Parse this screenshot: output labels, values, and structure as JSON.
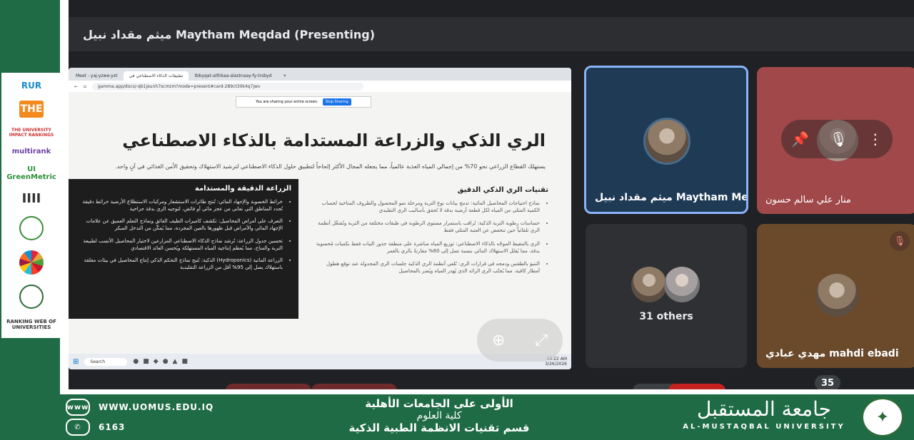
{
  "meet": {
    "presenting_title": "ميثم مقداد نبيل Maytham Meqdad (Presenting)",
    "participants": [
      {
        "name": "ميثم مقداد نبيل Maytham Meq..."
      },
      {
        "name": "منار علي سالم حسون"
      },
      {
        "name": "31 others"
      },
      {
        "name": "مهدي عبادي mahdi ebadi"
      }
    ],
    "participant_count": "35"
  },
  "screen": {
    "browser_tabs": [
      "Meet - yaj-yzwe-yxt",
      "تطبيقات الذكاء الاصطناعي في",
      "tbbyqat-althkaa-alastnaay-fy-trsbyd"
    ],
    "address": "gamma.app/docs/-qb1jeunh7scmzm?mode=present#card-289ct30k4q7jwv",
    "share_notice": "You are sharing your entire screen.",
    "stop_sharing": "Stop Sharing",
    "slide_title": "الري الذكي والزراعة المستدامة بالذكاء الاصطناعي",
    "slide_intro": "يستهلك القطاع الزراعي نحو 70% من إجمالي المياه العذبة عالمياً، مما يجعله المجال الأكثر إلحاحاً لتطبيق حلول الذكاء الاصطناعي لترشيد الاستهلاك وتحقيق الأمن الغذائي في آنٍ واحد.",
    "right_heading": "تقنيات الري الذكي الدقيق",
    "right_items": [
      "نماذج احتياجات المحاصيل المائية: تدمج بيانات نوع التربة ومرحلة نمو المحصول والظروف المناخية لحساب الكمية المثلى من المياه لكل قطعة أرضية بدقة لا تُحقق بأساليب الري التقليدي",
      "حساسات رطوبة التربة الذكية: تُراقب باستمرار مستوى الرطوبة في طبقات مختلفة من التربة وتُشغّل أنظمة الري تلقائياً حين تنخفض عن العتبة المثلى فقط",
      "الري بالتنقيط الموجّه بالذكاء الاصطناعي: توزيع المياه مباشرة على منطقة جذور النبات فقط بكميات مُحسوبة بدقة، مما يُقلل الاستهلاك المائي بنسبة تصل إلى 60% مقارنةً بالري بالغمر",
      "التنبؤ بالطقس ودمجه في قرارات الري: تُلغي أنظمة الري الذكية جلسات الري المجدولة عند توقع هطول أمطار كافية، مما يُجنّب الري الزائد الذي يُهدر المياه ويُضر بالمحاصيل"
    ],
    "left_heading": "الزراعة الدقيقة والمستدامة",
    "left_items": [
      "خرائط الخصوبة والإجهاد المائي: تُنتج طائرات الاستشعار ومركبات الاستطلاع الأرضية خرائط دقيقة تُحدد المناطق التي تعاني من عجز مائي أو فائض، لتوجيه الري بدقة جراحية",
      "التعرف على أمراض المحاصيل: تكشف كاميرات الطيف الفائق ونماذج التعلم العميق عن علامات الإجهاد المائي والأمراض قبل ظهورها بالعين المجردة، مما يُمكّن من التدخل المبكر",
      "تحسين جدول الزراعة: تُرشد نماذج الذكاء الاصطناعي المزارعين لاختيار المحاصيل الأنسب لطبيعة التربة والمناخ، مما يُعظم إنتاجية المياه المستهلكة ويُحسن العائد الاقتصادي",
      "الزراعة المائية (Hydroponics) الذكية: تُتيح نماذج التحكم الذكي إنتاج المحاصيل في بيئات مغلقة باستهلاك يصل إلى 95% أقل من الزراعة التقليدية"
    ],
    "taskbar_search": "Search",
    "taskbar_time": "10:22 AM",
    "taskbar_date": "3/26/2026"
  },
  "logos": [
    "RUR",
    "THE",
    "THE UNIVERSITY IMPACT RANKINGS",
    "multirank",
    "UI GreenMetric",
    "IIII",
    "SDG",
    "Federation of Arab Engineers",
    "RANKING WEB OF UNIVERSITIES"
  ],
  "banner": {
    "website": "WWW.UOMUS.EDU.IQ",
    "phone": "6163",
    "web_icon_label": "www",
    "line1": "الأولى على الجامعات الأهلية",
    "line2": "كلية العلوم",
    "line3": "قسم تقنيات الانظمة الطبية الذكية",
    "uni_ar": "جامعة المستقبل",
    "uni_en": "AL-MUSTAQBAL UNIVERSITY"
  },
  "colors": {
    "banner": "#1f6b45",
    "meet_bg": "#202124",
    "active_border": "#8ab4f8"
  },
  "icons": [
    "pin-icon",
    "mic-off-icon",
    "more-vert-icon",
    "zoom-in-icon",
    "fullscreen-icon",
    "globe-icon",
    "phone-icon"
  ]
}
